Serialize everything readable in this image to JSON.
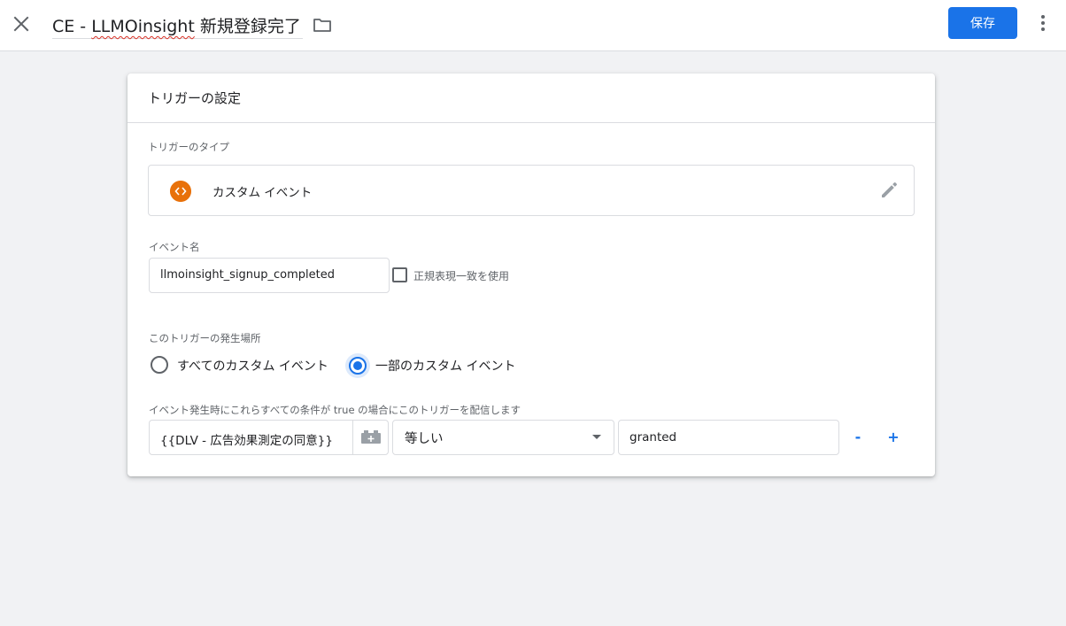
{
  "header": {
    "title_prefix": "CE - ",
    "title_misspelled": "LLMOinsight",
    "title_suffix": " 新規登録完了",
    "save_label": "保存"
  },
  "card": {
    "title": "トリガーの設定",
    "trigger_type_label": "トリガーのタイプ",
    "trigger_type_name": "カスタム イベント",
    "event_name_label": "イベント名",
    "event_name_value": "llmoinsight_signup_completed",
    "regex_label": "正規表現一致を使用",
    "regex_checked": false,
    "fires_on_label": "このトリガーの発生場所",
    "radio_all_label": "すべてのカスタム イベント",
    "radio_some_label": "一部のカスタム イベント",
    "selected_option": "some",
    "condition_label": "イベント発生時にこれらすべての条件が true の場合にこのトリガーを配信します",
    "condition": {
      "variable": "{{DLV - 広告効果測定の同意}}",
      "operator": "等しい",
      "value": "granted"
    },
    "remove_label": "-",
    "add_label": "+"
  },
  "colors": {
    "accent": "#1a73e8",
    "type_icon": "#e8710a"
  }
}
